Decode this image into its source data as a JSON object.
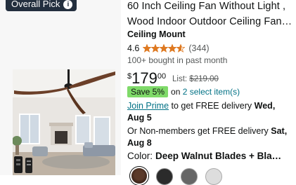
{
  "badge": {
    "label": "Overall Pick",
    "icon": "info-icon"
  },
  "product": {
    "title": "60 Inch Ceiling Fan Without Light , Wood Indoor Outdoor Ceiling Fan…",
    "brand": "Ceiling Mount",
    "rating_value": "4.6",
    "rating_stars": 4.6,
    "rating_count": "(344)",
    "bought": "100+ bought in past month"
  },
  "price": {
    "currency": "$",
    "whole": "179",
    "fraction": "00",
    "list_label": "List:",
    "list_price": "$219.00"
  },
  "savings": {
    "badge": "Save 5%",
    "text_prefix": "on",
    "text_link": "2 select item(s)"
  },
  "delivery": {
    "join_prime": "Join Prime",
    "prime_text": "to get FREE delivery",
    "prime_date": "Wed, Aug 5",
    "non_member_text": "Or Non-members get FREE delivery",
    "non_member_date": "Sat, Aug 8"
  },
  "color": {
    "label": "Color:",
    "value": "Deep Walnut Blades + Bla…"
  },
  "colors": {
    "star": "#de7921",
    "save_badge": "#7fda69",
    "link": "#007185"
  }
}
